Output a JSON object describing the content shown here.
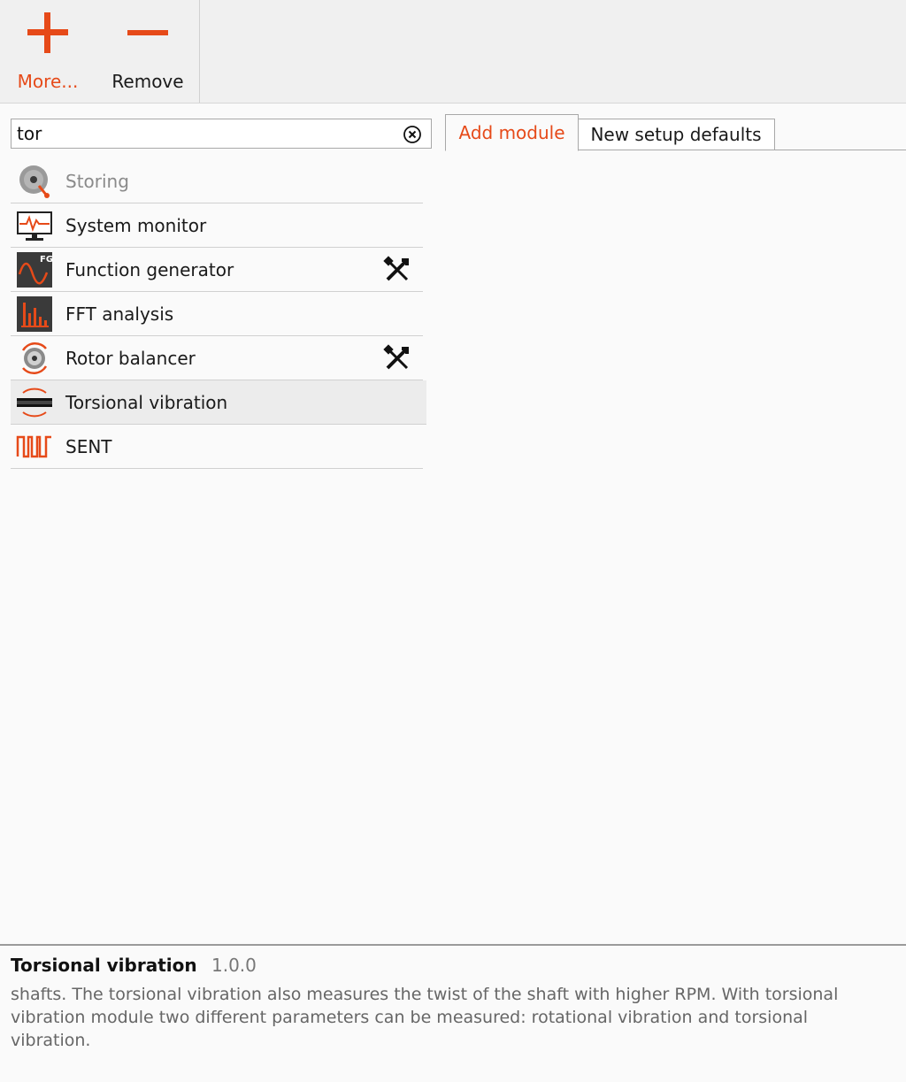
{
  "toolbar": {
    "more_label": "More...",
    "remove_label": "Remove"
  },
  "search": {
    "value": "tor"
  },
  "tabs": [
    {
      "label": "Add module",
      "active": true
    },
    {
      "label": "New setup defaults",
      "active": false
    }
  ],
  "modules": [
    {
      "label": "Storing",
      "icon": "storing-icon",
      "disabled": true,
      "tool": false
    },
    {
      "label": "System monitor",
      "icon": "system-monitor-icon",
      "disabled": false,
      "tool": false
    },
    {
      "label": "Function generator",
      "icon": "function-generator-icon",
      "disabled": false,
      "tool": true
    },
    {
      "label": "FFT analysis",
      "icon": "fft-analysis-icon",
      "disabled": false,
      "tool": false
    },
    {
      "label": "Rotor balancer",
      "icon": "rotor-balancer-icon",
      "disabled": false,
      "tool": true
    },
    {
      "label": "Torsional vibration",
      "icon": "torsional-vibration-icon",
      "disabled": false,
      "tool": false,
      "selected": true
    },
    {
      "label": "SENT",
      "icon": "sent-icon",
      "disabled": false,
      "tool": false
    }
  ],
  "icon_badges": {
    "function_generator": "FG"
  },
  "info": {
    "title": "Torsional vibration",
    "version": "1.0.0",
    "description": "shafts. The torsional vibration also measures the twist of the shaft with higher RPM. With torsional vibration module two different parameters can be measured:  rotational vibration and torsional vibration."
  },
  "colors": {
    "accent": "#e64a19",
    "dark_icon_bg": "#3a3a3a"
  }
}
